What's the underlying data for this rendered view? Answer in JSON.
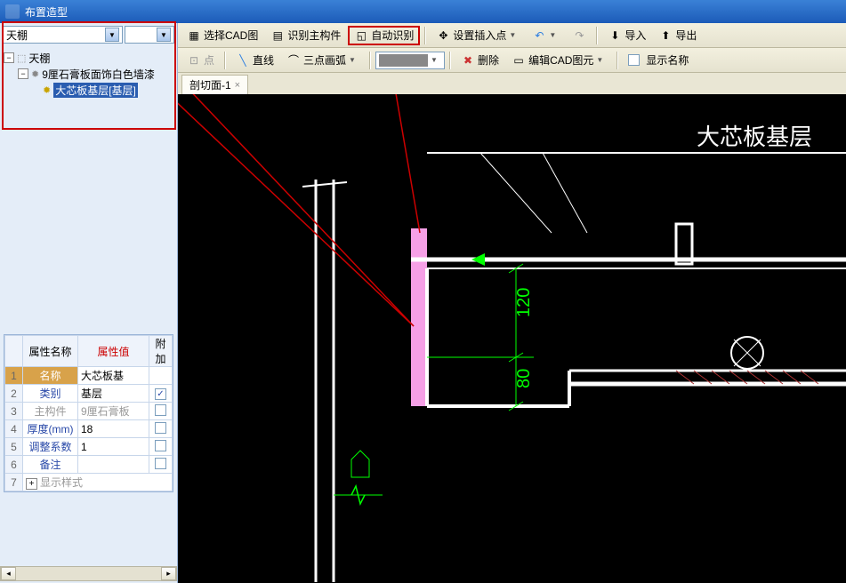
{
  "window": {
    "title": "布置造型"
  },
  "combo": {
    "category": "天棚"
  },
  "tree": {
    "root": "天棚",
    "child1": "9厘石膏板面饰白色墙漆",
    "child2": "大芯板基层[基层]"
  },
  "property_headers": {
    "name": "属性名称",
    "value": "属性值",
    "extra": "附加"
  },
  "properties": [
    {
      "n": "1",
      "name": "名称",
      "value": "大芯板基",
      "chk": ""
    },
    {
      "n": "2",
      "name": "类别",
      "value": "基层",
      "chk": "✓"
    },
    {
      "n": "3",
      "name": "主构件",
      "value": "9厘石膏板",
      "chk": "",
      "gray": true
    },
    {
      "n": "4",
      "name": "厚度(mm)",
      "value": "18",
      "chk": ""
    },
    {
      "n": "5",
      "name": "调整系数",
      "value": "1",
      "chk": ""
    },
    {
      "n": "6",
      "name": "备注",
      "value": "",
      "chk": ""
    },
    {
      "n": "7",
      "name": "显示样式",
      "value": "",
      "chk": "",
      "expand": true
    }
  ],
  "toolbar": {
    "select_cad": "选择CAD图",
    "recognize_main": "识别主构件",
    "auto_recognize": "自动识别",
    "set_insert": "设置插入点",
    "import": "导入",
    "export": "导出",
    "point": "点",
    "line": "直线",
    "arc": "三点画弧",
    "delete": "删除",
    "edit_cad": "编辑CAD图元",
    "show_name": "显示名称"
  },
  "tab": {
    "label": "剖切面-1"
  },
  "canvas": {
    "label": "大芯板基层",
    "dim1": "120",
    "dim2": "80"
  }
}
